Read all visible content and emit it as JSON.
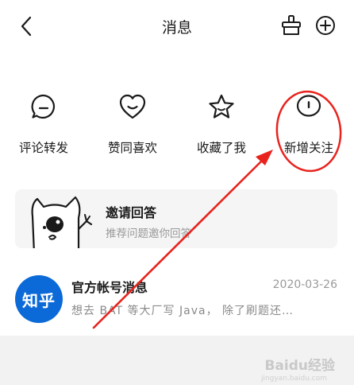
{
  "header": {
    "title": "消息",
    "back_icon": "chevron-left-icon",
    "clean_icon": "broom-icon",
    "add_icon": "plus-circle-icon"
  },
  "categories": [
    {
      "label": "评论转发",
      "icon": "comment-icon"
    },
    {
      "label": "赞同喜欢",
      "icon": "heart-icon"
    },
    {
      "label": "收藏了我",
      "icon": "star-icon"
    },
    {
      "label": "新增关注",
      "icon": "follow-icon"
    }
  ],
  "invite": {
    "title": "邀请回答",
    "subtitle": "推荐问题邀你回答",
    "icon": "mascot-icon"
  },
  "message": {
    "logo_text": "知乎",
    "title": "官方帐号消息",
    "date": "2020-03-26",
    "preview": "想去 BAT 等大厂写 Java， 除了刷题还…"
  },
  "watermark": {
    "text": "Baidu经验",
    "sub": "jingyan.baidu.com"
  },
  "annotation": {
    "color": "#e8231e"
  }
}
